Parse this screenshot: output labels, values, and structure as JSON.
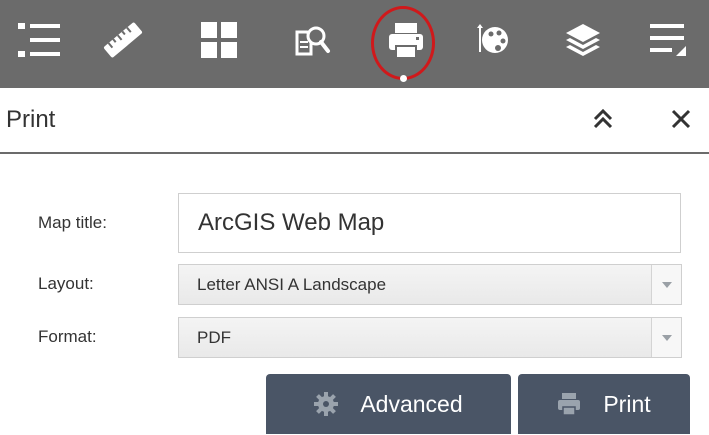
{
  "toolbar": {
    "tools": [
      {
        "icon": "list-icon",
        "active": false
      },
      {
        "icon": "measure-icon",
        "active": false
      },
      {
        "icon": "grid-icon",
        "active": false
      },
      {
        "icon": "find-icon",
        "active": false
      },
      {
        "icon": "print-icon",
        "active": true
      },
      {
        "icon": "palette-icon",
        "active": false
      },
      {
        "icon": "layers-icon",
        "active": false
      },
      {
        "icon": "menu-icon",
        "active": false
      }
    ],
    "background_color": "#6b6b6b",
    "highlight_color": "#d0191b"
  },
  "panel": {
    "title": "Print",
    "collapse_icon": "double-chevron-up-icon",
    "close_icon": "close-icon"
  },
  "form": {
    "map_title_label": "Map title:",
    "map_title_value": "ArcGIS Web Map",
    "layout_label": "Layout:",
    "layout_value": "Letter ANSI A Landscape",
    "format_label": "Format:",
    "format_value": "PDF"
  },
  "buttons": {
    "advanced_label": "Advanced",
    "advanced_icon": "gear-icon",
    "print_label": "Print",
    "print_icon": "print-icon",
    "button_color": "#4a5566"
  }
}
